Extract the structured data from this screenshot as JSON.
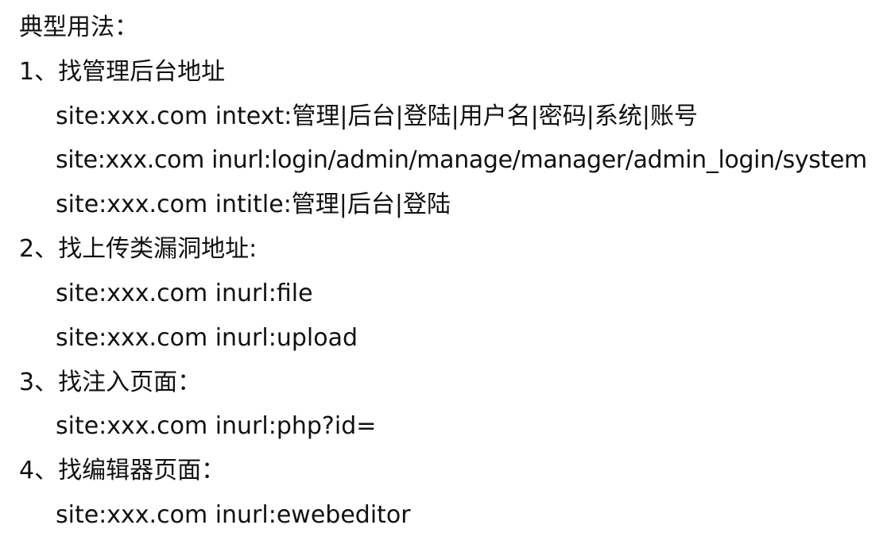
{
  "document": {
    "title": "典型用法：",
    "sections": [
      {
        "heading": "1、找管理后台地址",
        "queries": [
          "site:xxx.com intext:管理|后台|登陆|用户名|密码|系统|账号",
          "site:xxx.com inurl:login/admin/manage/manager/admin_login/system",
          "site:xxx.com intitle:管理|后台|登陆"
        ]
      },
      {
        "heading": "2、找上传类漏洞地址:",
        "queries": [
          "site:xxx.com inurl:file",
          "site:xxx.com inurl:upload"
        ]
      },
      {
        "heading": "3、找注入页面：",
        "queries": [
          "site:xxx.com inurl:php?id="
        ]
      },
      {
        "heading": "4、找编辑器页面：",
        "queries": [
          "site:xxx.com inurl:ewebeditor"
        ]
      }
    ]
  }
}
